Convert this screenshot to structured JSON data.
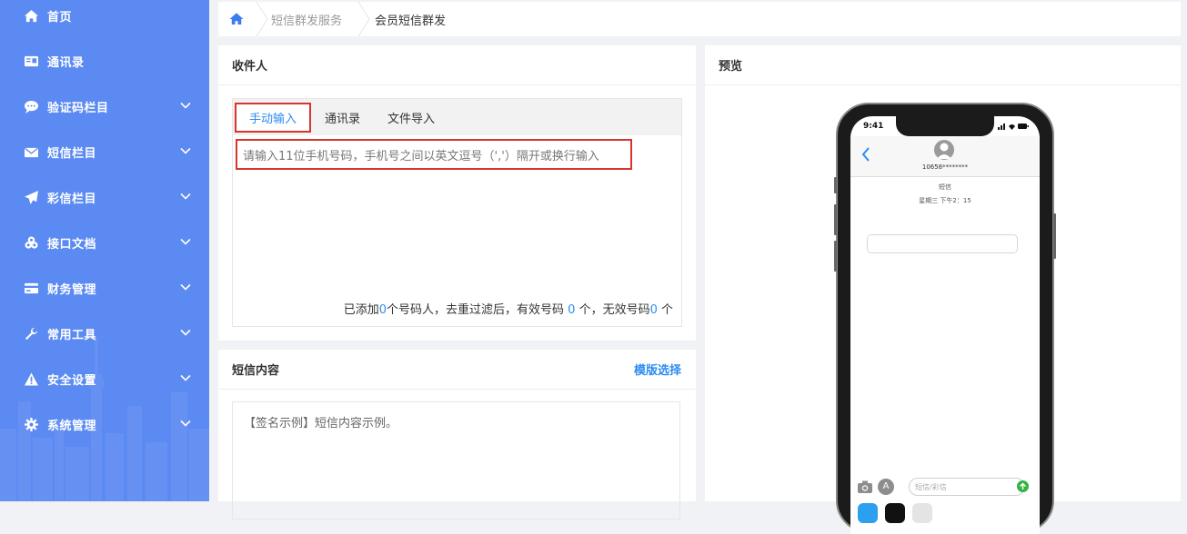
{
  "sidebar": {
    "accent_color": "#5b8af2",
    "items": [
      {
        "label": "首页",
        "icon": "home-icon",
        "expandable": false
      },
      {
        "label": "通讯录",
        "icon": "contact-card-icon",
        "expandable": false
      },
      {
        "label": "验证码栏目",
        "icon": "chat-bubble-icon",
        "expandable": true
      },
      {
        "label": "短信栏目",
        "icon": "envelope-icon",
        "expandable": true
      },
      {
        "label": "彩信栏目",
        "icon": "paper-plane-icon",
        "expandable": true
      },
      {
        "label": "接口文档",
        "icon": "link-cubes-icon",
        "expandable": true
      },
      {
        "label": "财务管理",
        "icon": "credit-card-icon",
        "expandable": true
      },
      {
        "label": "常用工具",
        "icon": "wrench-icon",
        "expandable": true
      },
      {
        "label": "安全设置",
        "icon": "warning-icon",
        "expandable": true
      },
      {
        "label": "系统管理",
        "icon": "gear-icon",
        "expandable": true
      }
    ]
  },
  "breadcrumb": {
    "items": [
      "短信群发服务",
      "会员短信群发"
    ]
  },
  "recipients": {
    "title": "收件人",
    "tabs": [
      "手动输入",
      "通讯录",
      "文件导入"
    ],
    "active_tab": "手动输入",
    "input_placeholder": "请输入11位手机号码，手机号之间以英文逗号（','）隔开或换行输入",
    "count": {
      "prefix": "已添加",
      "added": "0",
      "mid1": "个号码人，去重过滤后，有效号码 ",
      "valid": "0",
      "mid2": " 个，无效号码",
      "invalid": "0",
      "suffix": " 个"
    }
  },
  "sms_content": {
    "title": "短信内容",
    "template_link": "模版选择",
    "text": "【签名示例】短信内容示例。"
  },
  "preview": {
    "title": "预览",
    "phone": {
      "time": "9:41",
      "contact": "10658********",
      "thread_label": "短信",
      "thread_time": "星期三 下午2：15",
      "input_placeholder": "短信/彩信"
    }
  },
  "colors": {
    "link": "#2d8cf0",
    "highlight_border": "#d9342b"
  }
}
